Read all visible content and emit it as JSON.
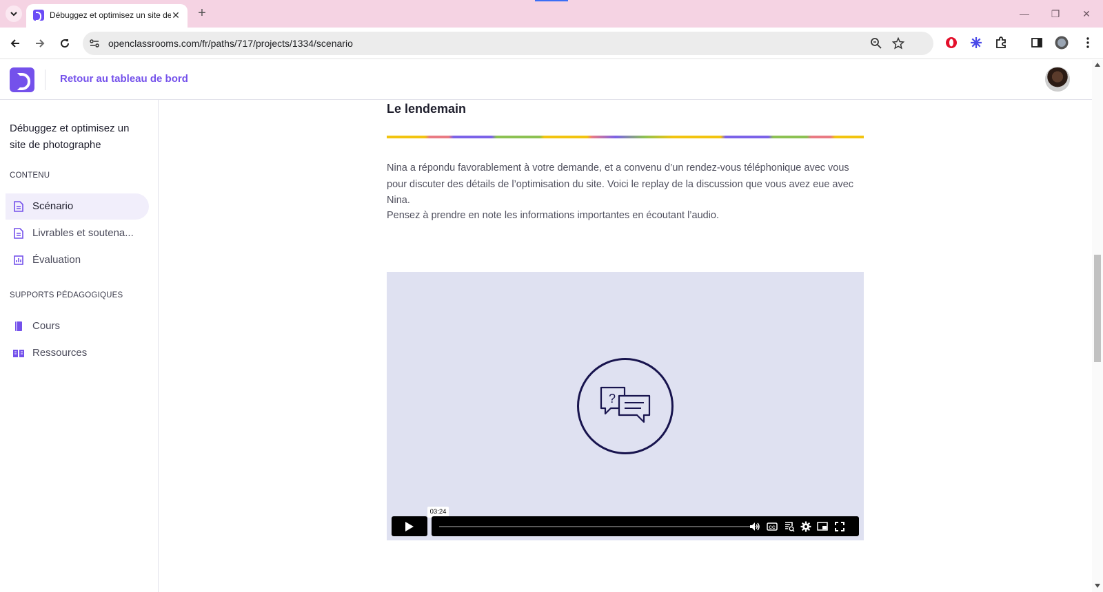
{
  "browser": {
    "tab_title": "Débuggez et optimisez un site de photographe",
    "tab_close": "✕",
    "new_tab": "+",
    "url": "openclassrooms.com/fr/paths/717/projects/1334/scenario"
  },
  "header": {
    "back_link": "Retour au tableau de bord"
  },
  "sidebar": {
    "project_title": "Débuggez et optimisez un site de photographe",
    "content_label": "CONTENU",
    "content_items": [
      {
        "label": "Scénario",
        "icon": "document-icon"
      },
      {
        "label": "Livrables et soutena...",
        "icon": "document-icon"
      },
      {
        "label": "Évaluation",
        "icon": "chart-icon"
      }
    ],
    "supports_label": "SUPPORTS PÉDAGOGIQUES",
    "support_items": [
      {
        "label": "Cours",
        "icon": "book-icon"
      },
      {
        "label": "Ressources",
        "icon": "open-book-icon"
      }
    ]
  },
  "main": {
    "heading": "Le lendemain",
    "paragraph1": "Nina a répondu favorablement à votre demande, et a convenu d’un rendez-vous téléphonique avec vous pour discuter des détails de l’optimisation du site. Voici le replay de la discussion que vous avez eue avec Nina.",
    "paragraph2": "Pensez à prendre en note les informations importantes en écoutant l’audio.",
    "video": {
      "duration": "03:24",
      "progress": 0
    }
  },
  "colors": {
    "brand": "#7451eb",
    "tabbar": "#f5d3e3",
    "video_bg": "#dfe1f1",
    "video_icon": "#18144e"
  }
}
